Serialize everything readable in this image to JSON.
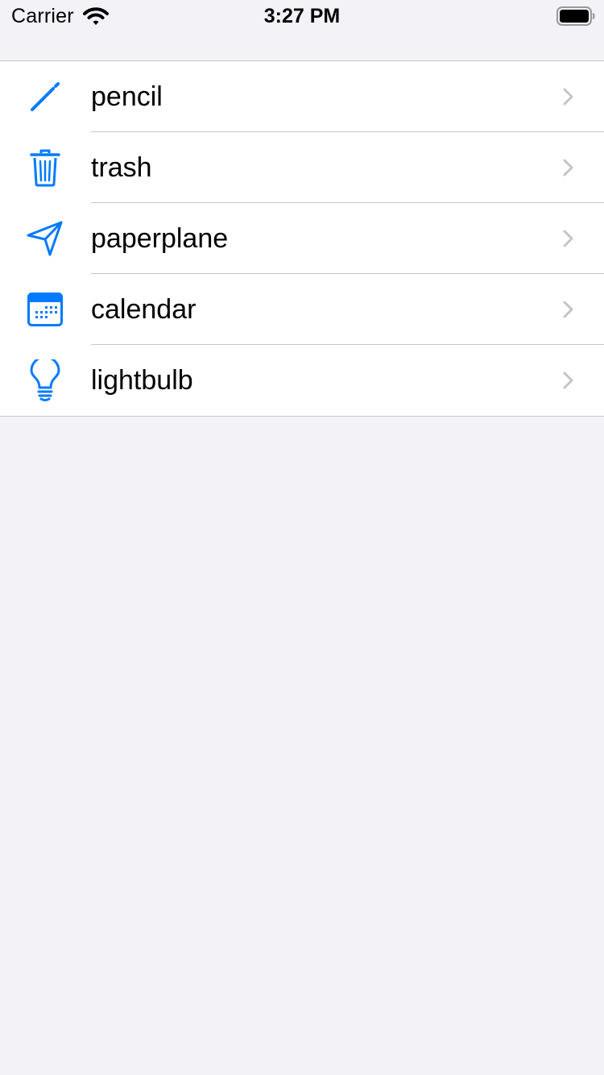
{
  "status_bar": {
    "carrier": "Carrier",
    "time": "3:27 PM",
    "wifi_icon": "wifi-icon",
    "battery_icon": "battery-full-icon"
  },
  "colors": {
    "accent": "#007aff",
    "chevron": "#c4c4c7",
    "background": "#f2f2f7",
    "separator": "#c6c6c8"
  },
  "rows": [
    {
      "label": "pencil",
      "icon": "pencil-icon"
    },
    {
      "label": "trash",
      "icon": "trash-icon"
    },
    {
      "label": "paperplane",
      "icon": "paperplane-icon"
    },
    {
      "label": "calendar",
      "icon": "calendar-icon"
    },
    {
      "label": "lightbulb",
      "icon": "lightbulb-icon"
    }
  ]
}
